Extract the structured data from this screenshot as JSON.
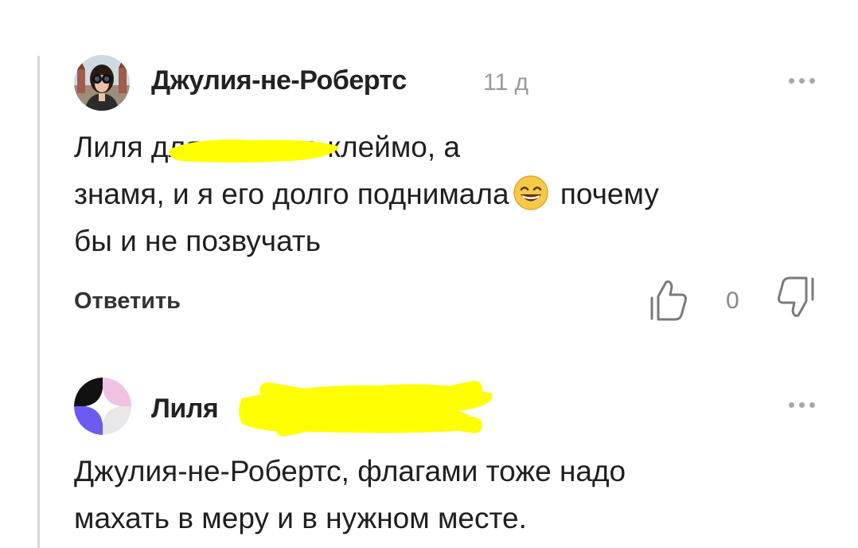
{
  "comments": [
    {
      "author": "Джулия-не-Робертс",
      "timestamp": "11 д",
      "text_before_emoji": "Лиля ",
      "text_middle": "         для меня не клеймо, а\nзнамя, и я его долго поднимала",
      "text_after_emoji": " почему\nбы и не позвучать",
      "reply_label": "Ответить",
      "like_count": "0",
      "more_icon": "more-horizontal-icon",
      "like_icon": "thumbs-up-icon",
      "dislike_icon": "thumbs-down-icon",
      "emoji": "grinning-face-with-smiling-eyes",
      "redacted": true
    },
    {
      "author": "Лиля",
      "text": "Джулия-не-Робертс, флагами тоже надо\nмахать в меру и в нужном месте.",
      "more_icon": "more-horizontal-icon",
      "redacted": true
    }
  ],
  "colors": {
    "redaction": "#ffff00",
    "thread_line": "#d9d9d9",
    "muted": "#9a9a9a",
    "avatar2_pink": "#f1c2e3",
    "avatar2_purple": "#6b5bf0",
    "avatar2_grey": "#e8e8ea"
  }
}
